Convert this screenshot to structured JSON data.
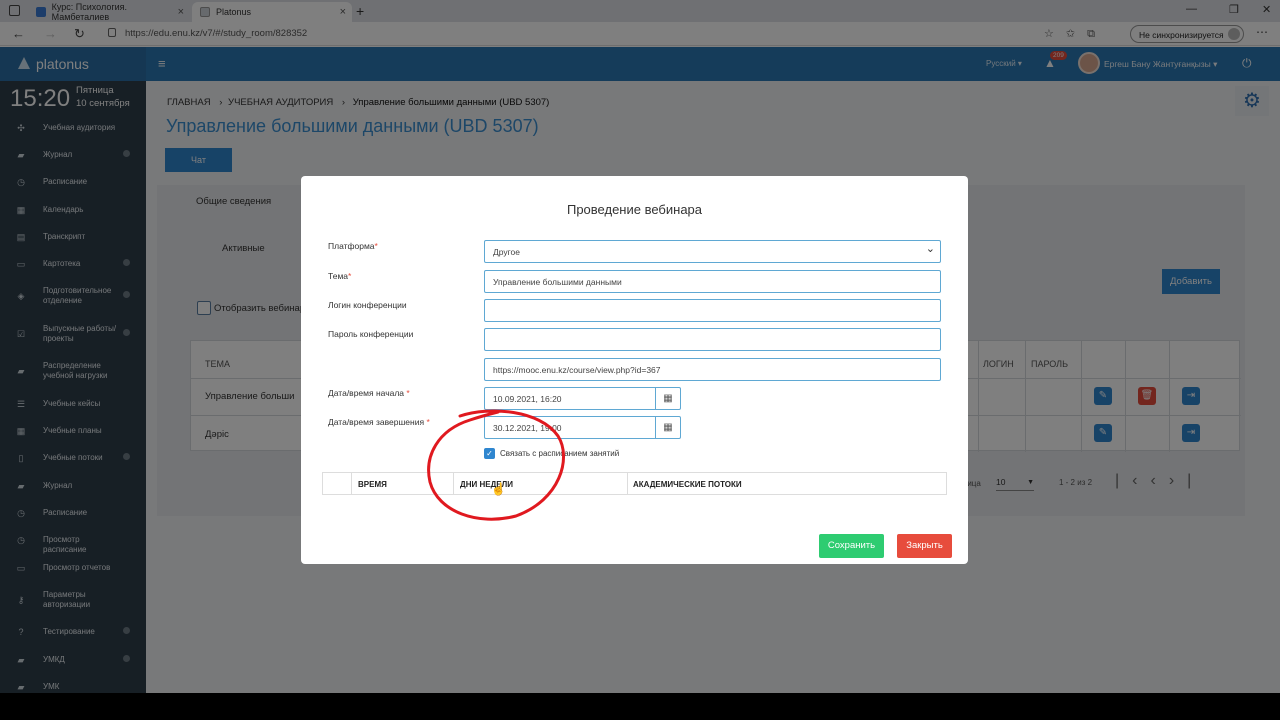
{
  "browser": {
    "tabs": [
      {
        "label": "Курс: Психология. Мамбеталиев"
      },
      {
        "label": "Platonus"
      }
    ],
    "url": "https://edu.enu.kz/v7/#/study_room/828352",
    "sync_label": "Не синхронизируется"
  },
  "header": {
    "logo": "platonus",
    "lang": "Русский",
    "notifications": "209",
    "user": "Ергеш Бану Жантуғанқызы"
  },
  "sidebar": {
    "time": "15:20",
    "weekday": "Пятница",
    "date": "10 сентября",
    "items": [
      {
        "label": "Учебная аудитория"
      },
      {
        "label": "Журнал"
      },
      {
        "label": "Расписание"
      },
      {
        "label": "Календарь"
      },
      {
        "label": "Транскрипт"
      },
      {
        "label": "Картотека"
      },
      {
        "label": "Подготовительное отделение"
      },
      {
        "label": "Выпускные работы/проекты"
      },
      {
        "label": "Распределение учебной нагрузки"
      },
      {
        "label": "Учебные кейсы"
      },
      {
        "label": "Учебные планы"
      },
      {
        "label": "Учебные потоки"
      },
      {
        "label": "Журнал"
      },
      {
        "label": "Расписание"
      },
      {
        "label": "Просмотр расписание"
      },
      {
        "label": "Просмотр отчетов"
      },
      {
        "label": "Параметры авторизации"
      },
      {
        "label": "Тестирование"
      },
      {
        "label": "УМКД"
      },
      {
        "label": "УМК"
      }
    ]
  },
  "page": {
    "breadcrumb": {
      "home": "ГЛАВНАЯ",
      "sep1": "›",
      "room": "УЧЕБНАЯ АУДИТОРИЯ",
      "sep2": "›",
      "current": "Управление большими данными (UBD 5307)"
    },
    "title": "Управление большими данными (UBD 5307)",
    "chat_label": "Чат",
    "tab_general": "Общие сведения",
    "tab_active": "Активные",
    "checkbox_label": "Отобразить вебинар",
    "add_label": "Добавить",
    "table": {
      "headers": {
        "topic": "ТЕМА",
        "login": "ЛОГИН",
        "password": "ПАРОЛЬ"
      },
      "rows": [
        {
          "topic": "Управление больши"
        },
        {
          "topic": "Дәріс"
        }
      ]
    },
    "pagination": {
      "label": "раница",
      "size": "10",
      "range": "1 - 2 из 2"
    }
  },
  "modal": {
    "title": "Проведение вебинара",
    "fields": {
      "platform": {
        "label": "Платформа",
        "value": "Другое"
      },
      "topic": {
        "label": "Тема",
        "value": "Управление большими данными"
      },
      "login": {
        "label": "Логин конференции",
        "value": ""
      },
      "password": {
        "label": "Пароль конференции",
        "value": ""
      },
      "link": {
        "value": "https://mooc.enu.kz/course/view.php?id=367"
      },
      "start": {
        "label": "Дата/время начала",
        "value": "10.09.2021, 16:20"
      },
      "end": {
        "label": "Дата/время завершения",
        "value": "30.12.2021, 19:00"
      }
    },
    "link_schedule_label": "Связать с расписанием занятий",
    "table_headers": {
      "time": "ВРЕМЯ",
      "days": "ДНИ НЕДЕЛИ",
      "streams": "АКАДЕМИЧЕСКИЕ ПОТОКИ"
    },
    "save_label": "Сохранить",
    "close_label": "Закрыть"
  },
  "colors": {
    "header_blue": "#2b78b5",
    "sidebar_dark": "#2f3e4b",
    "accent_blue": "#2f86cf",
    "save_green": "#2ecc71",
    "close_red": "#e74c3c",
    "annotation_red": "#e0191f"
  }
}
